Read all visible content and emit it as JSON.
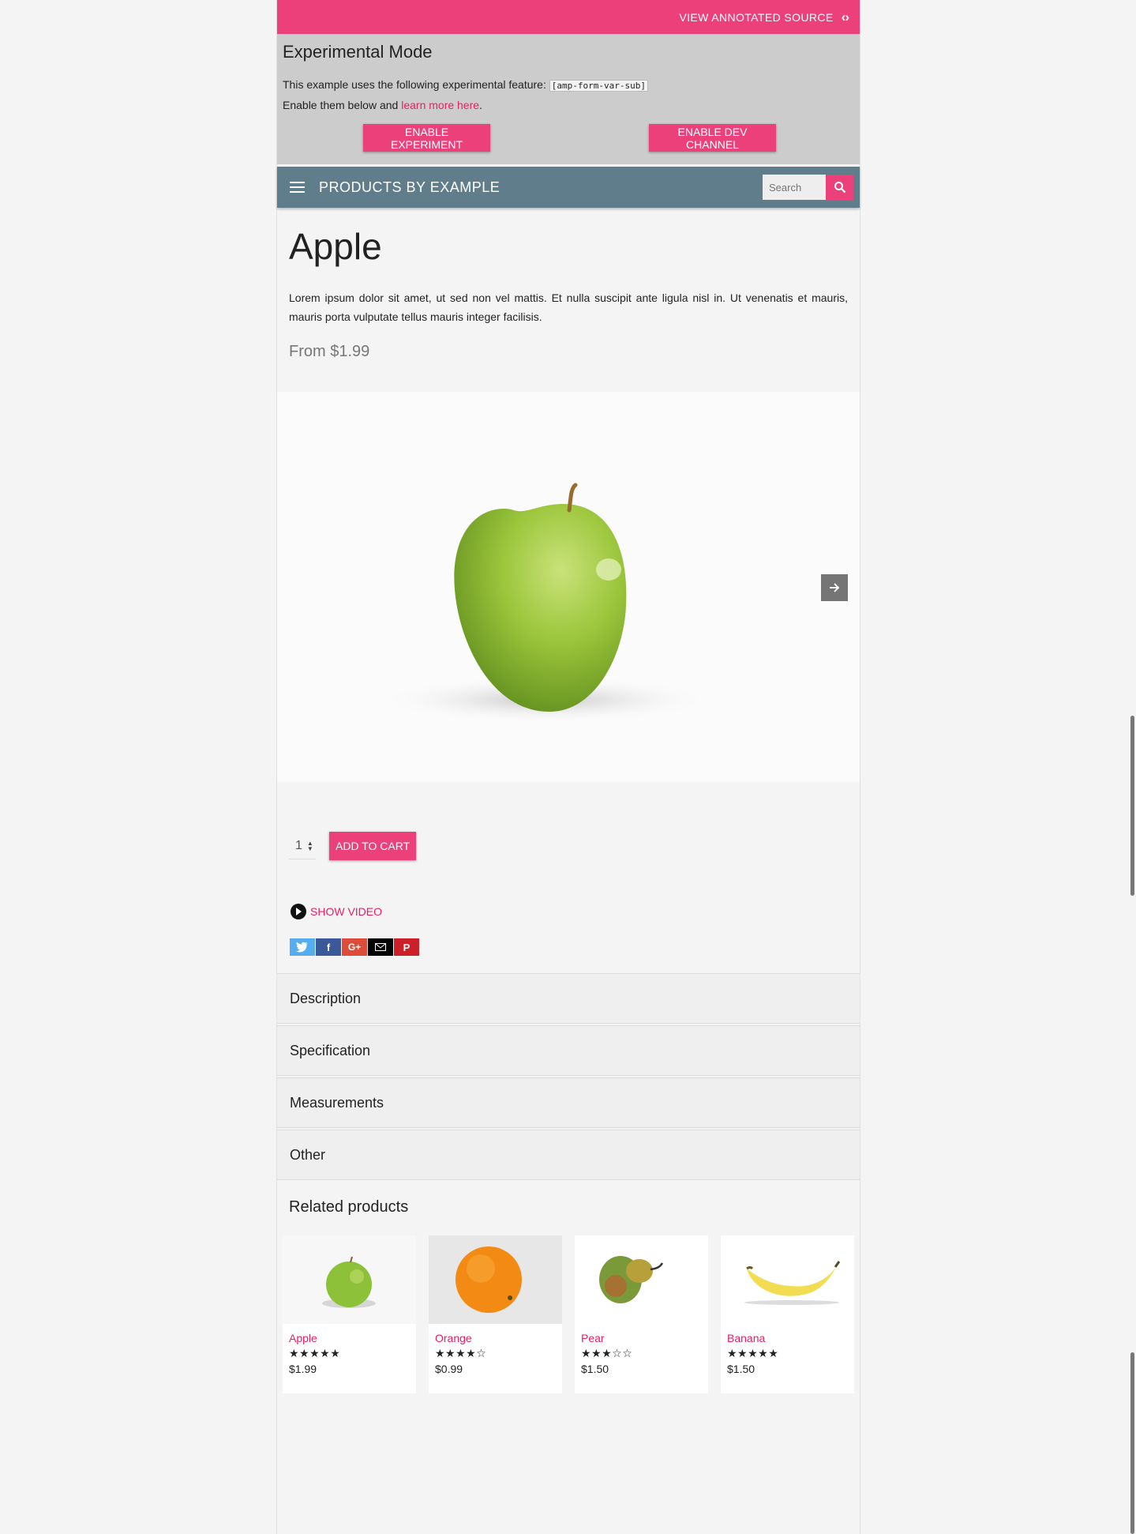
{
  "topbar": {
    "source_label": "VIEW ANNOTATED SOURCE",
    "code_icon": "code-icon"
  },
  "experimental": {
    "heading": "Experimental Mode",
    "line1": "This example uses the following experimental feature:",
    "feature": "[amp-form-var-sub]",
    "line2_prefix": "Enable them below and",
    "link": "learn more here",
    "line2_suffix": ".",
    "enable_experiment": "ENABLE EXPERIMENT",
    "enable_dev_channel": "ENABLE DEV CHANNEL"
  },
  "header": {
    "title": "PRODUCTS BY EXAMPLE",
    "search_placeholder": "Search"
  },
  "product": {
    "name": "Apple",
    "description": "Lorem ipsum dolor sit amet, ut sed non vel mattis. Et nulla suscipit ante ligula nisl in. Ut venenatis et mauris, mauris porta vulputate tellus mauris integer facilisis.",
    "price": "From $1.99",
    "quantity": "1",
    "add_to_cart": "ADD TO CART",
    "show_video": "SHOW VIDEO"
  },
  "accordion": [
    "Description",
    "Specification",
    "Measurements",
    "Other"
  ],
  "related": {
    "title": "Related products",
    "items": [
      {
        "name": "Apple",
        "stars": "★★★★★",
        "price": "$1.99"
      },
      {
        "name": "Orange",
        "stars": "★★★★☆",
        "price": "$0.99"
      },
      {
        "name": "Pear",
        "stars": "★★★☆☆",
        "price": "$1.50"
      },
      {
        "name": "Banana",
        "stars": "★★★★★",
        "price": "$1.50"
      }
    ]
  },
  "colors": {
    "accent": "#ec407a",
    "header": "#607d8b",
    "experimental_bg": "#cccccc"
  }
}
